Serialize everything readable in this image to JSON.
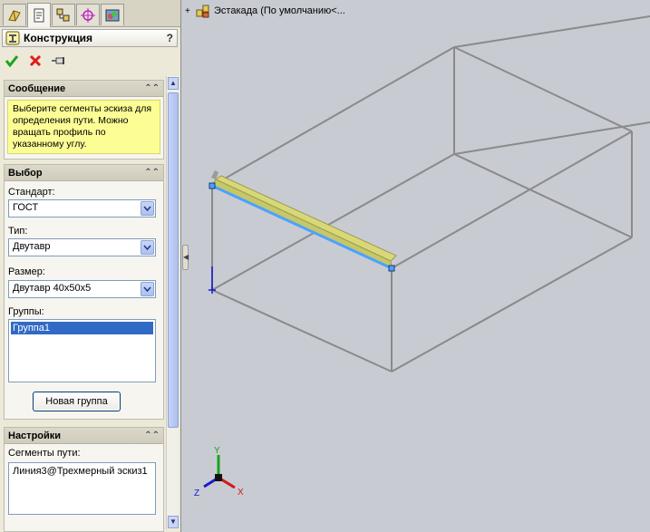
{
  "panel_title": "Конструкция",
  "help_icon": "?",
  "message": {
    "header": "Сообщение",
    "text": "Выберите сегменты эскиза для определения пути. Можно вращать профиль по указанному углу."
  },
  "selection": {
    "header": "Выбор",
    "standard_label": "Стандарт:",
    "standard_value": "ГОСТ",
    "type_label": "Тип:",
    "type_value": "Двутавр",
    "size_label": "Размер:",
    "size_value": "Двутавр 40x50x5",
    "groups_label": "Группы:",
    "groups": [
      "Группа1"
    ],
    "new_group_button": "Новая группа"
  },
  "settings": {
    "header": "Настройки",
    "path_segments_label": "Сегменты пути:",
    "path_segments_value": "Линия3@Трехмерный эскиз1"
  },
  "tree": {
    "expand": "+",
    "root_label": "Эстакада  (По умолчанию<..."
  },
  "triad": {
    "x": "X",
    "y": "Y",
    "z": "Z"
  },
  "colors": {
    "accept": "#1aa31a",
    "cancel": "#e01b1b",
    "message_bg": "#fdfd96",
    "highlight_edge": "#4aa3ff",
    "profile": "#d8d87a",
    "wireframe": "#8a8a8a",
    "viewport_bg": "#c9cbd3"
  }
}
